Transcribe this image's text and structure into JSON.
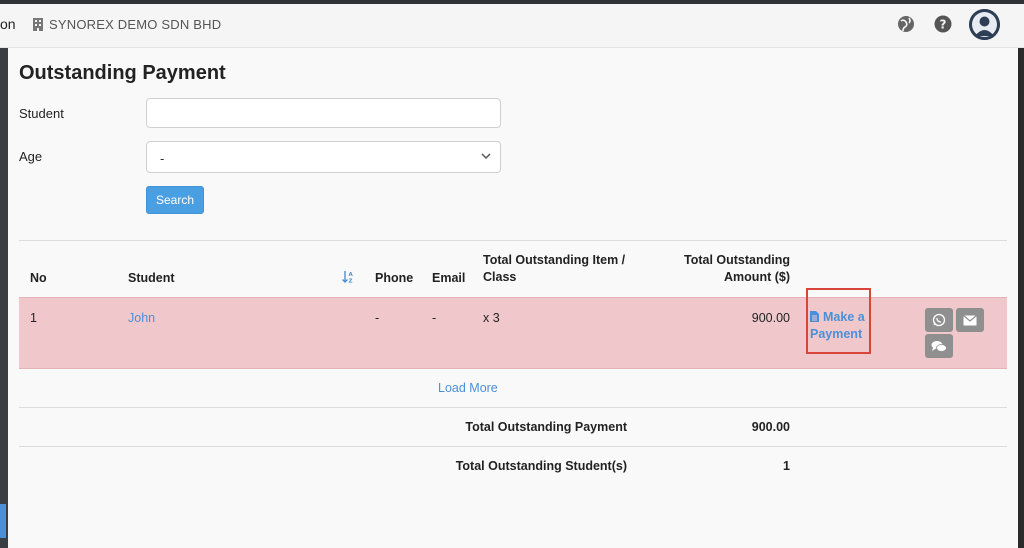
{
  "header": {
    "brand_tail": "on",
    "company": "SYNOREX DEMO SDN BHD",
    "icons": [
      "globe-icon",
      "help-icon",
      "user-avatar"
    ]
  },
  "page": {
    "title": "Outstanding Payment"
  },
  "filters": {
    "student_label": "Student",
    "student_value": "",
    "age_label": "Age",
    "age_selected": "-",
    "search_label": "Search"
  },
  "table": {
    "columns": {
      "no": "No",
      "student": "Student",
      "phone": "Phone",
      "email": "Email",
      "items_line1": "Total Outstanding Item /",
      "items_line2": "Class",
      "amount_line1": "Total Outstanding",
      "amount_line2": "Amount ($)"
    },
    "rows": [
      {
        "no": "1",
        "student": "John",
        "phone": "-",
        "email": "-",
        "items": "x 3",
        "amount": "900.00",
        "action_line1": "Make a",
        "action_line2": "Payment"
      }
    ],
    "load_more": "Load More"
  },
  "totals": {
    "payment_label": "Total Outstanding Payment",
    "payment_value": "900.00",
    "students_label": "Total Outstanding Student(s)",
    "students_value": "1"
  },
  "colors": {
    "accent": "#4a90d9",
    "highlight_row": "#f0c8cc",
    "annotation_box": "#d9453a",
    "search_button": "#4a9fe3"
  }
}
